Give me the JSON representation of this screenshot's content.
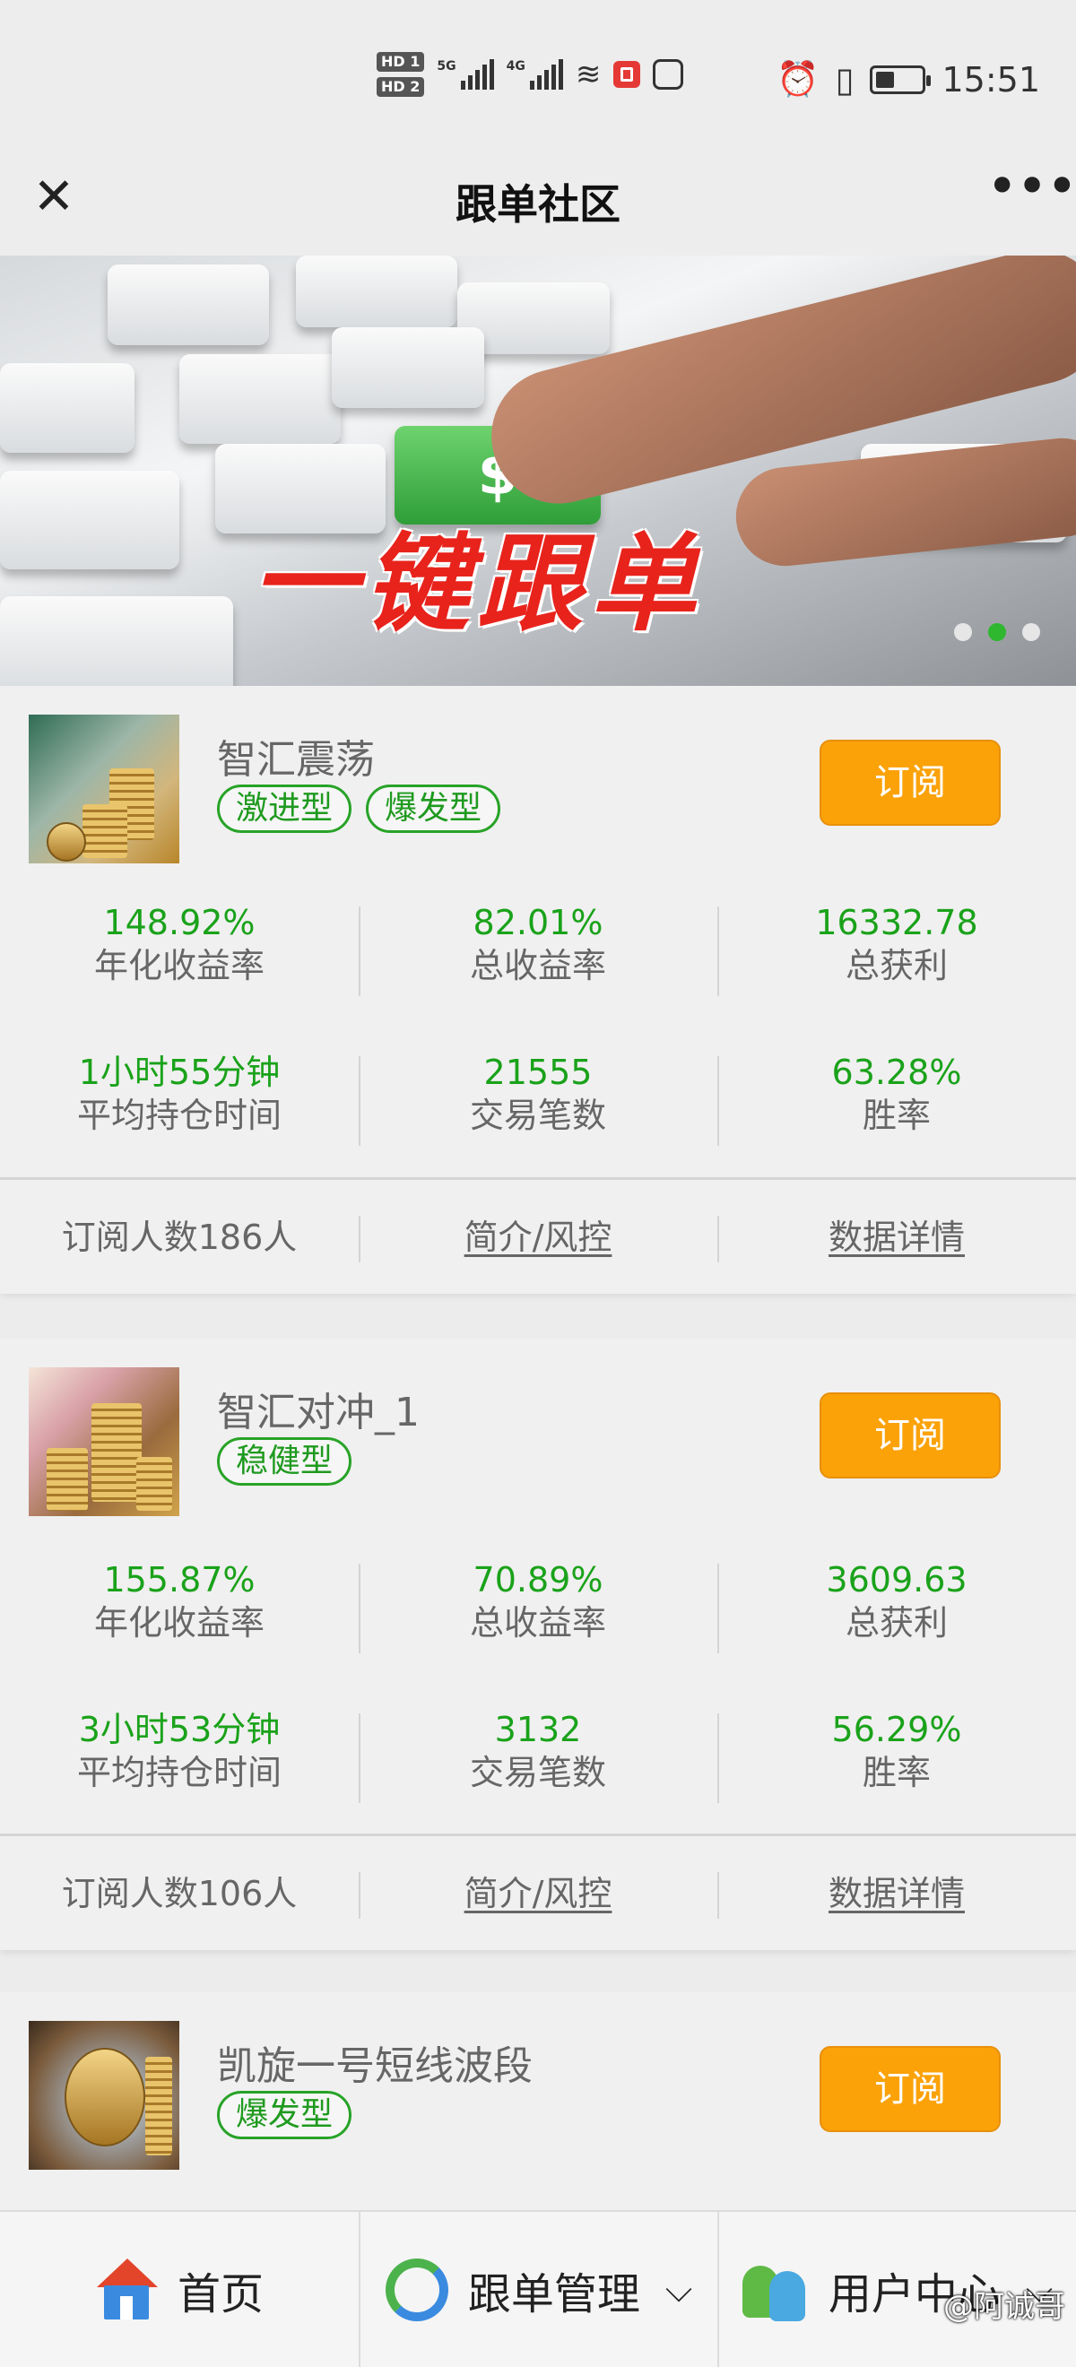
{
  "status_bar": {
    "hd1": "HD 1",
    "hd2": "HD 2",
    "sig1": "5G",
    "sig2": "4G",
    "time": "15:51"
  },
  "nav": {
    "title": "跟单社区",
    "close_icon": "close-icon",
    "more_icon": "more-icon"
  },
  "banner": {
    "text": "一键跟单",
    "key_symbol": "$",
    "dot_count": 3,
    "active_dot": 2
  },
  "cards": [
    {
      "name": "智汇震荡",
      "tags": [
        "激进型",
        "爆发型"
      ],
      "subscribe_label": "订阅",
      "stats": [
        {
          "value": "148.92%",
          "label": "年化收益率"
        },
        {
          "value": "82.01%",
          "label": "总收益率"
        },
        {
          "value": "16332.78",
          "label": "总获利"
        },
        {
          "value": "1小时55分钟",
          "label": "平均持仓时间"
        },
        {
          "value": "21555",
          "label": "交易笔数"
        },
        {
          "value": "63.28%",
          "label": "胜率"
        }
      ],
      "subscribers": "订阅人数186人",
      "intro_link": "简介/风控",
      "detail_link": "数据详情"
    },
    {
      "name": "智汇对冲_1",
      "tags": [
        "稳健型"
      ],
      "subscribe_label": "订阅",
      "stats": [
        {
          "value": "155.87%",
          "label": "年化收益率"
        },
        {
          "value": "70.89%",
          "label": "总收益率"
        },
        {
          "value": "3609.63",
          "label": "总获利"
        },
        {
          "value": "3小时53分钟",
          "label": "平均持仓时间"
        },
        {
          "value": "3132",
          "label": "交易笔数"
        },
        {
          "value": "56.29%",
          "label": "胜率"
        }
      ],
      "subscribers": "订阅人数106人",
      "intro_link": "简介/风控",
      "detail_link": "数据详情"
    },
    {
      "name": "凯旋一号短线波段",
      "tags": [
        "爆发型"
      ],
      "subscribe_label": "订阅"
    }
  ],
  "tabbar": {
    "home": "首页",
    "follow": "跟单管理",
    "user": "用户中心"
  },
  "watermark": "@阿诚哥",
  "colors": {
    "accent_green": "#1aa21a",
    "subscribe_orange": "#fba209",
    "banner_red": "#e8231c"
  }
}
